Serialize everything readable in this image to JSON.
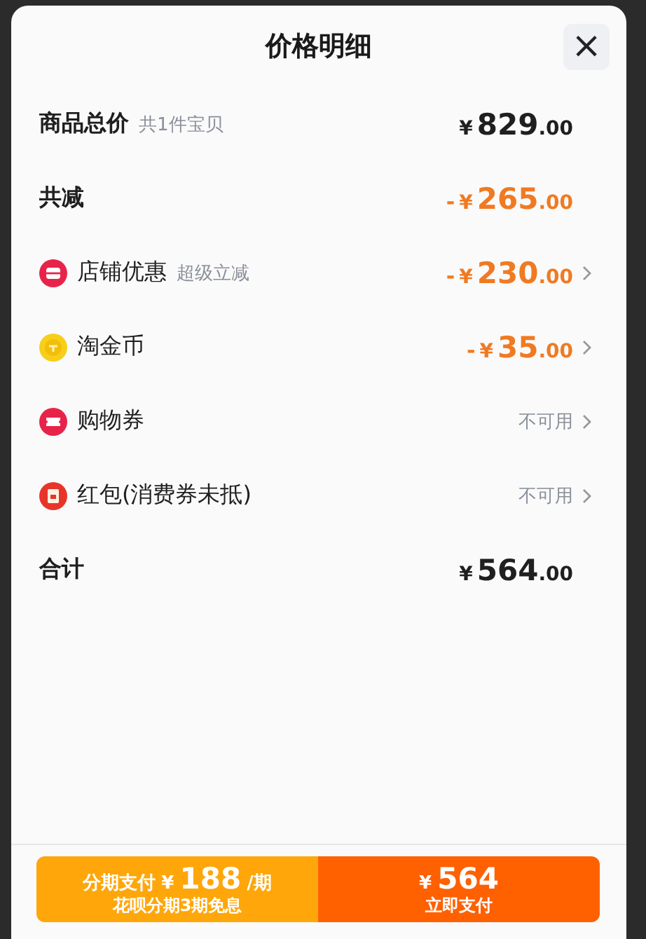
{
  "sheet": {
    "title": "价格明细",
    "close": "×"
  },
  "rows": [
    {
      "kind": "summary",
      "label": "商品总价",
      "note": "共1件宝贝",
      "amount": {
        "currency": "¥",
        "integer": "829",
        "decimal": ".00",
        "highlight": false
      }
    },
    {
      "kind": "summary",
      "label": "共减",
      "amount": {
        "sign": "-",
        "currency": "¥",
        "integer": "265",
        "decimal": ".00",
        "highlight": true
      }
    },
    {
      "kind": "shop",
      "label": "店铺优惠",
      "note": "超级立减",
      "amount": {
        "sign": "-",
        "currency": "¥",
        "integer": "230",
        "decimal": ".00",
        "highlight": true
      }
    },
    {
      "kind": "coin",
      "label": "淘金币",
      "amount": {
        "sign": "-",
        "currency": "¥",
        "integer": "35",
        "decimal": ".00",
        "highlight": true
      }
    },
    {
      "kind": "ticket",
      "label": "购物券",
      "status": "不可用"
    },
    {
      "kind": "envelope",
      "label": "红包(消费券未抵)",
      "status": "不可用"
    },
    {
      "kind": "summary",
      "label": "合计",
      "amount": {
        "currency": "¥",
        "integer": "564",
        "decimal": ".00",
        "highlight": false
      }
    }
  ],
  "footer": {
    "installment": {
      "prefix": "分期支付",
      "currency": "¥",
      "amount": "188",
      "unit": "/期",
      "subtitle": "花呗分期3期免息"
    },
    "pay": {
      "currency": "¥",
      "amount": "564",
      "subtitle": "立即支付"
    }
  }
}
